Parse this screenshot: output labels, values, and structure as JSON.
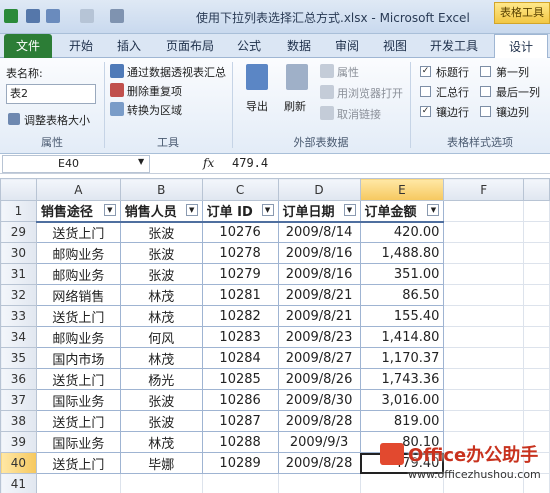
{
  "window": {
    "title": "使用下拉列表选择汇总方式.xlsx - Microsoft Excel",
    "context_tab": "表格工具"
  },
  "tabs": [
    "文件",
    "开始",
    "插入",
    "页面布局",
    "公式",
    "数据",
    "审阅",
    "视图",
    "开发工具",
    "设计"
  ],
  "ribbon": {
    "properties": {
      "name_label": "表名称:",
      "name_value": "表2",
      "resize_label": "调整表格大小",
      "group_label": "属性"
    },
    "tools": {
      "pivot_label": "通过数据透视表汇总",
      "remove_dup_label": "删除重复项",
      "convert_label": "转换为区域",
      "group_label": "工具"
    },
    "external": {
      "export_label": "导出",
      "refresh_label": "刷新",
      "props_label": "属性",
      "browser_label": "用浏览器打开",
      "unlink_label": "取消链接",
      "group_label": "外部表数据"
    },
    "style_options": {
      "header_row": "标题行",
      "total_row": "汇总行",
      "banded_rows": "镶边行",
      "first_col": "第一列",
      "last_col": "最后一列",
      "banded_cols": "镶边列",
      "group_label": "表格样式选项"
    }
  },
  "formula_bar": {
    "cell_ref": "E40",
    "fx": "fx",
    "value": "479.4"
  },
  "grid": {
    "columns": [
      "A",
      "B",
      "C",
      "D",
      "E",
      "F"
    ],
    "header_row_num": "1",
    "headers": [
      "销售途径",
      "销售人员",
      "订单 ID",
      "订单日期",
      "订单金额"
    ],
    "rows": [
      {
        "n": "29",
        "a": "送货上门",
        "b": "张波",
        "c": "10276",
        "d": "2009/8/14",
        "e": "420.00"
      },
      {
        "n": "30",
        "a": "邮购业务",
        "b": "张波",
        "c": "10278",
        "d": "2009/8/16",
        "e": "1,488.80"
      },
      {
        "n": "31",
        "a": "邮购业务",
        "b": "张波",
        "c": "10279",
        "d": "2009/8/16",
        "e": "351.00"
      },
      {
        "n": "32",
        "a": "网络销售",
        "b": "林茂",
        "c": "10281",
        "d": "2009/8/21",
        "e": "86.50"
      },
      {
        "n": "33",
        "a": "送货上门",
        "b": "林茂",
        "c": "10282",
        "d": "2009/8/21",
        "e": "155.40"
      },
      {
        "n": "34",
        "a": "邮购业务",
        "b": "何风",
        "c": "10283",
        "d": "2009/8/23",
        "e": "1,414.80"
      },
      {
        "n": "35",
        "a": "国内市场",
        "b": "林茂",
        "c": "10284",
        "d": "2009/8/27",
        "e": "1,170.37"
      },
      {
        "n": "36",
        "a": "送货上门",
        "b": "杨光",
        "c": "10285",
        "d": "2009/8/26",
        "e": "1,743.36"
      },
      {
        "n": "37",
        "a": "国际业务",
        "b": "张波",
        "c": "10286",
        "d": "2009/8/30",
        "e": "3,016.00"
      },
      {
        "n": "38",
        "a": "送货上门",
        "b": "张波",
        "c": "10287",
        "d": "2009/8/28",
        "e": "819.00"
      },
      {
        "n": "39",
        "a": "国际业务",
        "b": "林茂",
        "c": "10288",
        "d": "2009/9/3",
        "e": "80.10"
      },
      {
        "n": "40",
        "a": "送货上门",
        "b": "毕娜",
        "c": "10289",
        "d": "2009/8/28",
        "e": "479.40"
      }
    ],
    "last_row_num": "41"
  },
  "watermark": {
    "title": "Office办公助手",
    "url": "www.officezhushou.com"
  },
  "colors": {
    "file_tab": "#2c7d36",
    "context_tab": "#f2c744",
    "selected_header": "#f6c85f",
    "table_border": "#9fb4d2"
  }
}
